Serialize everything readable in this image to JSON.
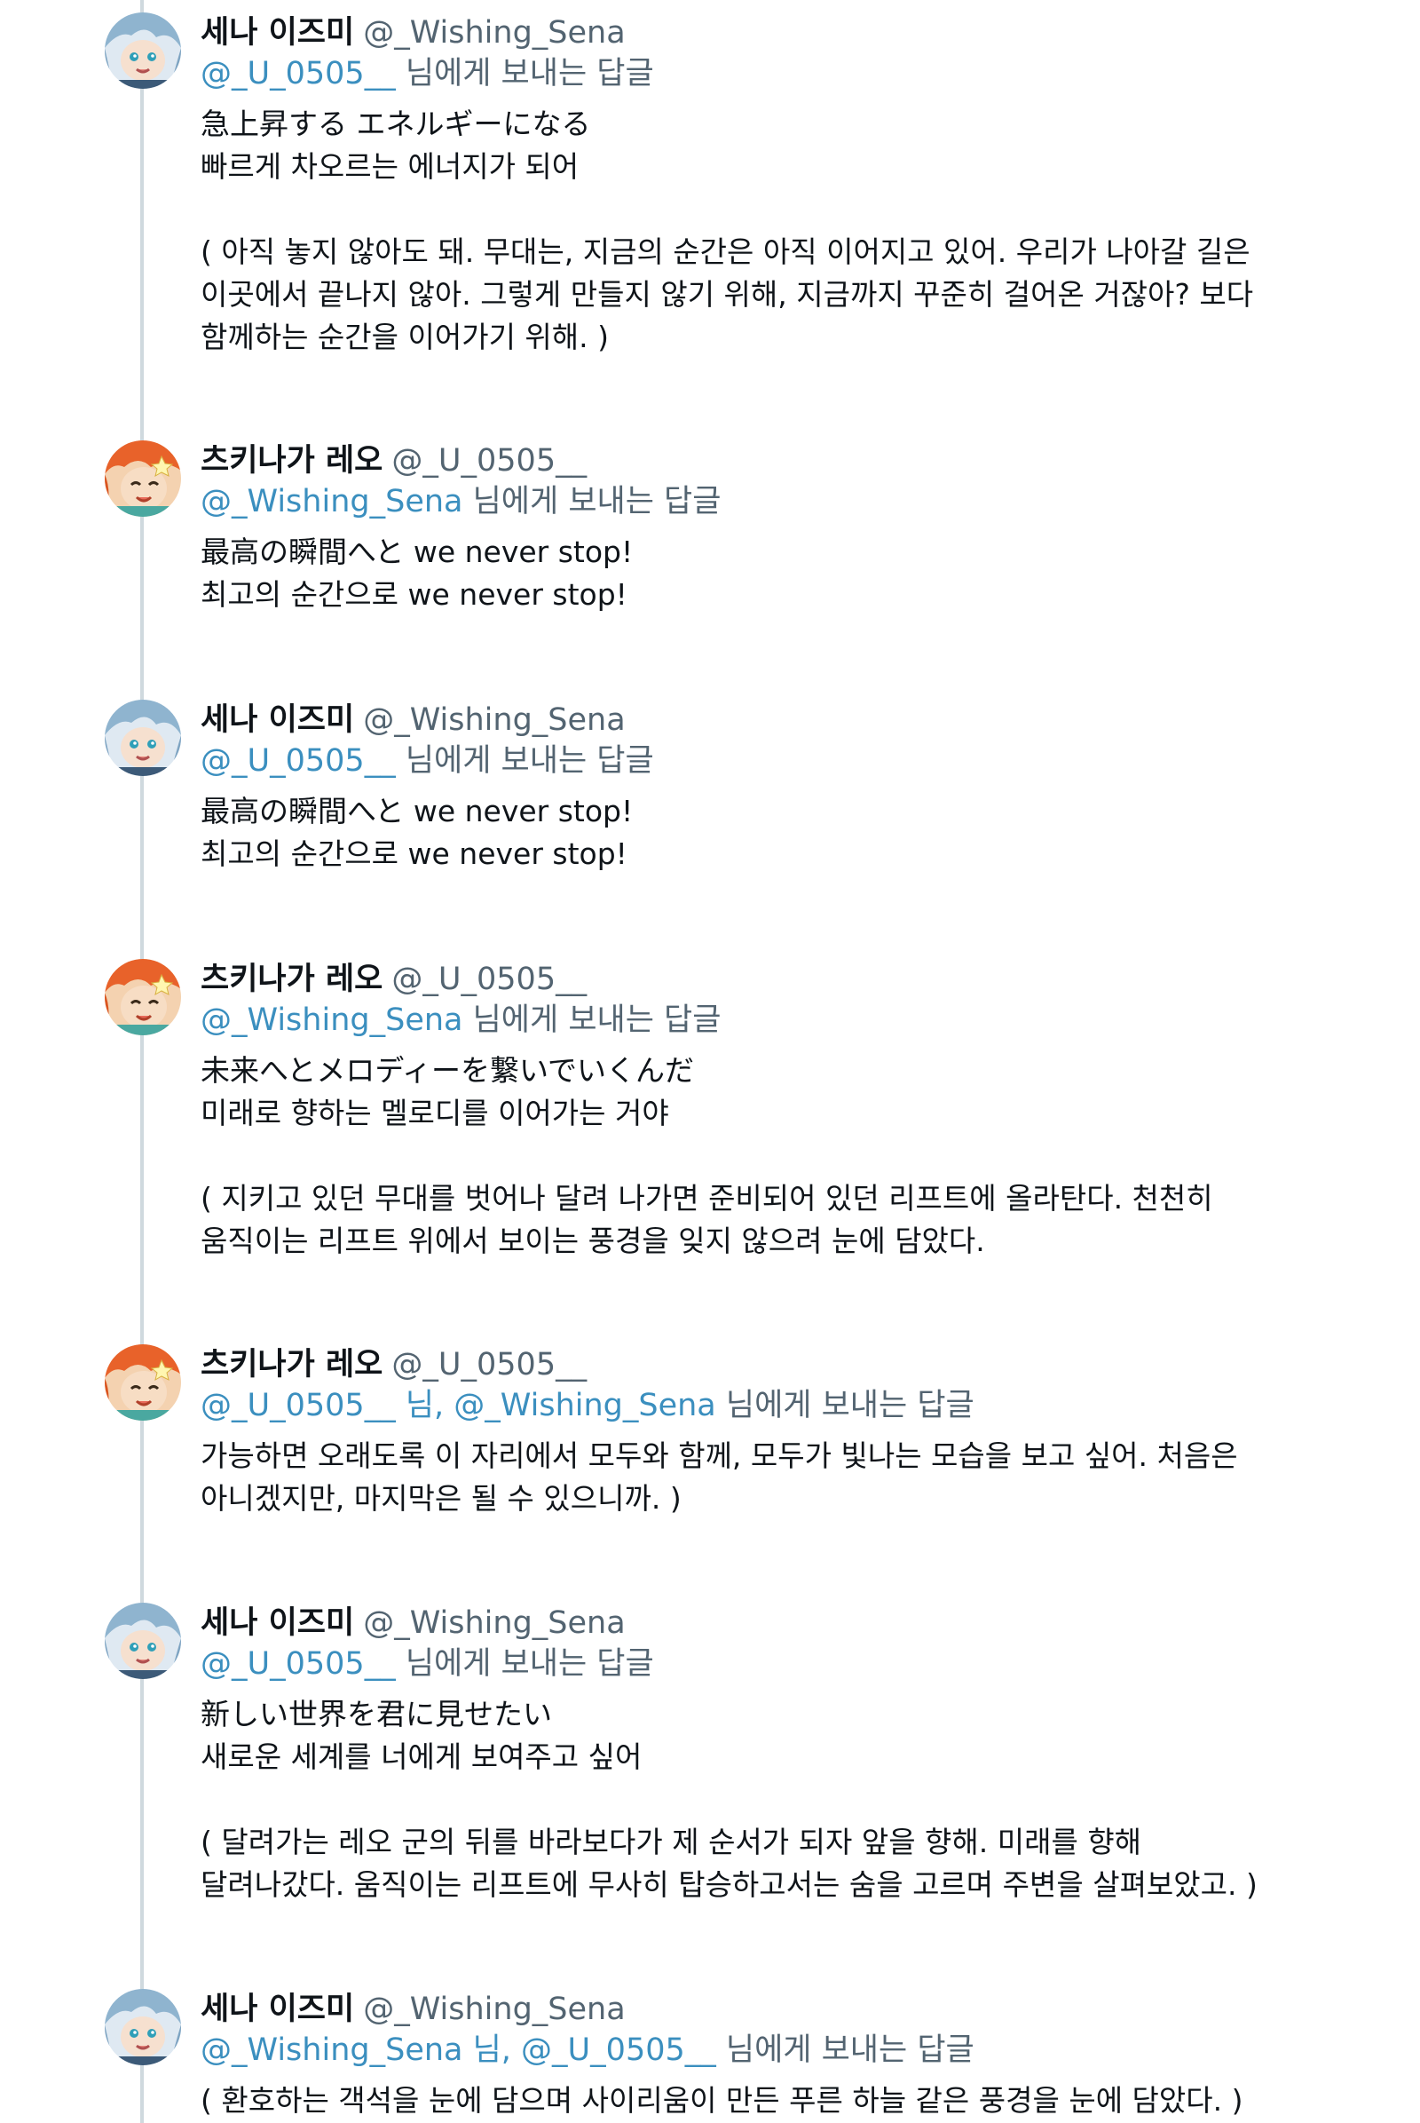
{
  "thread": {
    "tweets": [
      {
        "name": "세나 이즈미",
        "handle": "@_Wishing_Sena",
        "avatar": "sena-avatar",
        "reply_to": [
          {
            "text": "@_U_0505__",
            "mention": true
          },
          {
            "text": " 님에게 보내는 답글",
            "mention": false
          }
        ],
        "lines": [
          "急上昇する エネルギーになる",
          "빠르게 차오르는 에너지가 되어",
          "",
          "( 아직 놓지 않아도 돼. 무대는, 지금의 순간은 아직 이어지고 있어. 우리가 나아갈 길은",
          "이곳에서 끝나지 않아. 그렇게 만들지 않기 위해, 지금까지 꾸준히 걸어온 거잖아? 보다",
          "함께하는 순간을 이어가기 위해. )"
        ]
      },
      {
        "name": "츠키나가 레오",
        "handle": "@_U_0505__",
        "avatar": "leo-avatar",
        "reply_to": [
          {
            "text": "@_Wishing_Sena",
            "mention": true
          },
          {
            "text": " 님에게 보내는 답글",
            "mention": false
          }
        ],
        "lines": [
          "最高の瞬間へと we never stop!",
          "최고의 순간으로 we never stop!"
        ]
      },
      {
        "name": "세나 이즈미",
        "handle": "@_Wishing_Sena",
        "avatar": "sena-avatar",
        "reply_to": [
          {
            "text": "@_U_0505__",
            "mention": true
          },
          {
            "text": " 님에게 보내는 답글",
            "mention": false
          }
        ],
        "lines": [
          "最高の瞬間へと we never stop!",
          "최고의 순간으로 we never stop!"
        ]
      },
      {
        "name": "츠키나가 레오",
        "handle": "@_U_0505__",
        "avatar": "leo-avatar",
        "reply_to": [
          {
            "text": "@_Wishing_Sena",
            "mention": true
          },
          {
            "text": " 님에게 보내는 답글",
            "mention": false
          }
        ],
        "lines": [
          "未来へとメロディーを繋いでいくんだ",
          "미래로 향하는 멜로디를 이어가는 거야",
          "",
          "( 지키고 있던 무대를 벗어나 달려 나가면 준비되어 있던 리프트에 올라탄다. 천천히",
          "움직이는 리프트 위에서 보이는 풍경을 잊지 않으려 눈에 담았다."
        ]
      },
      {
        "name": "츠키나가 레오",
        "handle": "@_U_0505__",
        "avatar": "leo-avatar",
        "reply_to": [
          {
            "text": "@_U_0505__ 님, @_Wishing_Sena",
            "mention": true
          },
          {
            "text": " 님에게 보내는 답글",
            "mention": false
          }
        ],
        "lines": [
          "가능하면 오래도록 이 자리에서 모두와 함께, 모두가 빛나는 모습을 보고 싶어. 처음은",
          "아니겠지만, 마지막은 될 수 있으니까. )"
        ]
      },
      {
        "name": "세나 이즈미",
        "handle": "@_Wishing_Sena",
        "avatar": "sena-avatar",
        "reply_to": [
          {
            "text": "@_U_0505__",
            "mention": true
          },
          {
            "text": " 님에게 보내는 답글",
            "mention": false
          }
        ],
        "lines": [
          "新しい世界を君に見せたい",
          "새로운 세계를 너에게 보여주고 싶어",
          "",
          "( 달려가는 레오 군의 뒤를 바라보다가 제 순서가 되자 앞을 향해. 미래를 향해",
          "달려나갔다. 움직이는 리프트에 무사히 탑승하고서는 숨을 고르며 주변을 살펴보았고. )"
        ]
      },
      {
        "name": "세나 이즈미",
        "handle": "@_Wishing_Sena",
        "avatar": "sena-avatar",
        "reply_to": [
          {
            "text": "@_Wishing_Sena 님, @_U_0505__",
            "mention": true
          },
          {
            "text": " 님에게 보내는 답글",
            "mention": false
          }
        ],
        "lines": [
          "( 환호하는 객석을 눈에 담으며 사이리움이 만든 푸른 하늘 같은 풍경을 눈에 담았다. )"
        ]
      }
    ]
  }
}
